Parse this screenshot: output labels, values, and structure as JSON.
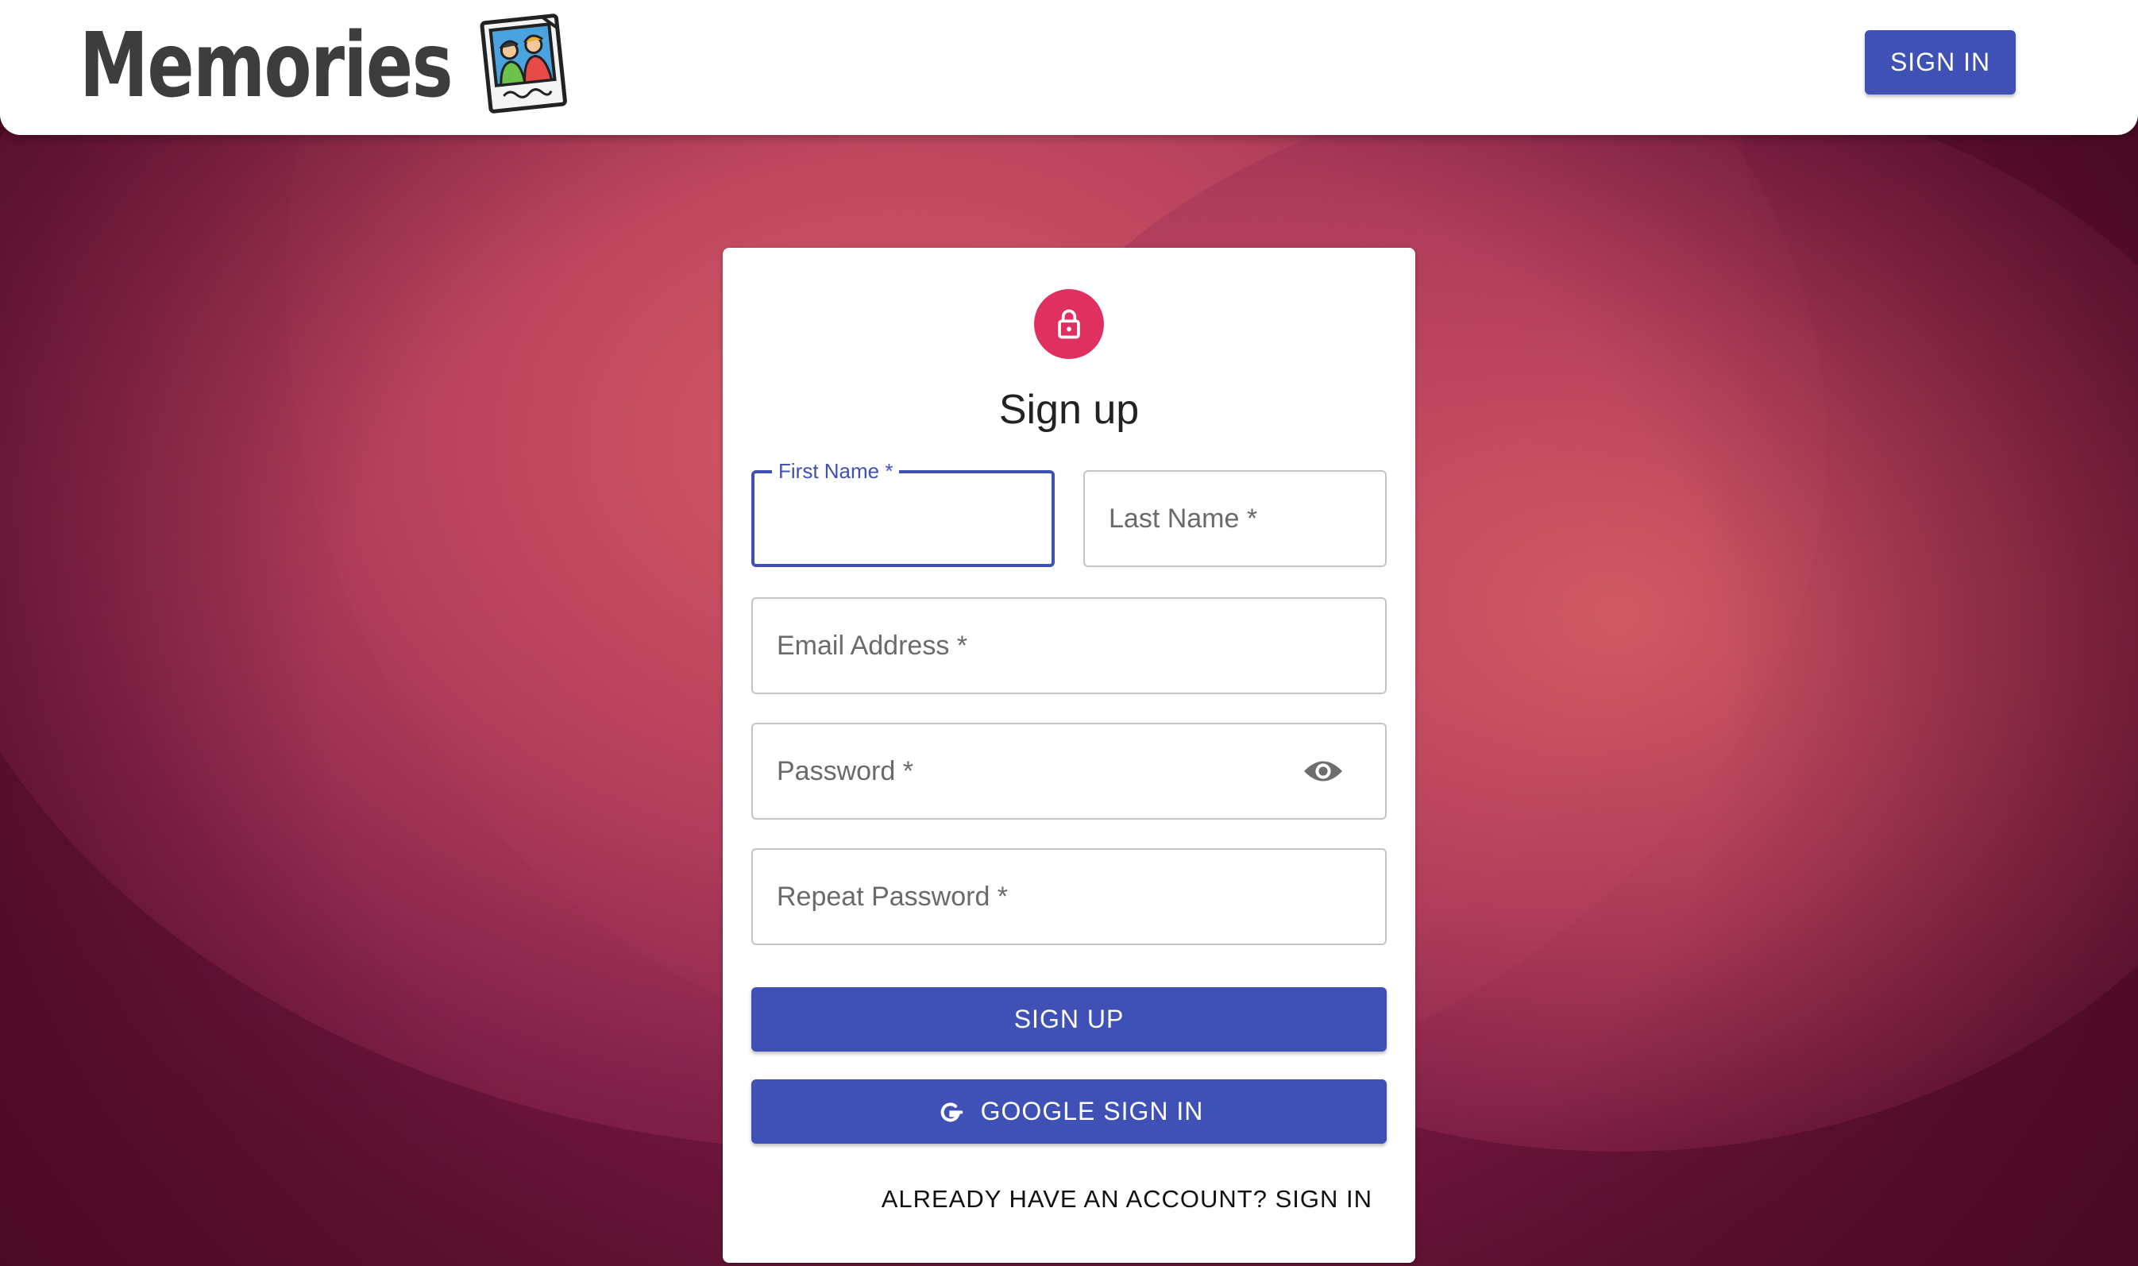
{
  "header": {
    "brand": "Memories",
    "logo_icon": "photo-memories-icon",
    "signin_label": "SIGN IN"
  },
  "form": {
    "title": "Sign up",
    "lock_icon": "lock-icon",
    "first_name_label": "First Name *",
    "last_name_label": "Last Name *",
    "email_label": "Email Address *",
    "password_label": "Password *",
    "password_toggle_icon": "eye-icon",
    "repeat_password_label": "Repeat Password *",
    "signup_button": "SIGN UP",
    "google_button": "GOOGLE SIGN IN",
    "google_icon": "google-icon",
    "switch_link": "ALREADY HAVE AN ACCOUNT? SIGN IN"
  },
  "colors": {
    "primary": "#3f51b5",
    "avatar": "#e0305f",
    "background": "#7a1845"
  }
}
